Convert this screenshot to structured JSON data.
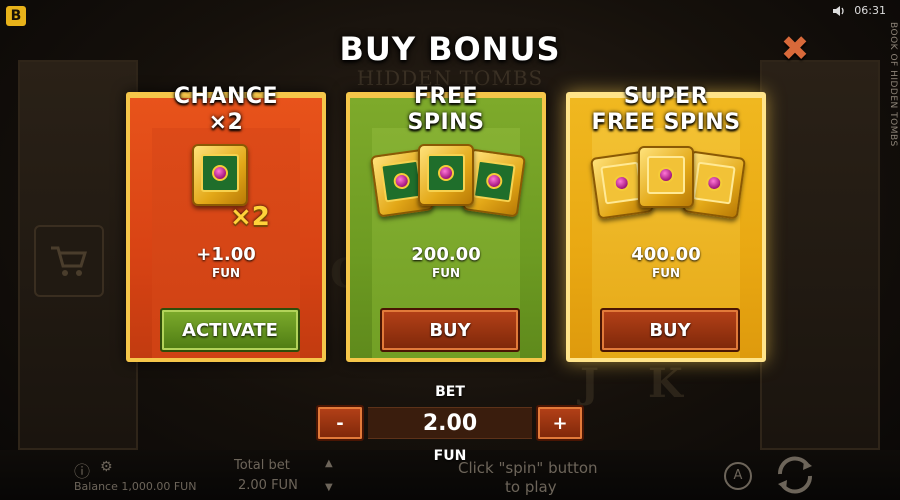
{
  "logo_letter": "B",
  "status": {
    "time": "06:31",
    "sound_icon": "speaker-icon"
  },
  "side_title": "BOOK OF HIDDEN TOMBS",
  "background": {
    "game_title": "HIDDEN TOMBS",
    "reel_letters": [
      "K",
      "J",
      "Q"
    ]
  },
  "modal": {
    "title": "BUY BONUS",
    "close_icon": "close-icon",
    "options": [
      {
        "title_line1": "CHANCE",
        "title_line2": "×2",
        "multiplier": "×2",
        "price": "+1.00",
        "currency": "FUN",
        "button": "ACTIVATE",
        "colors": {
          "card": "#e04c17",
          "button": "#5e8e1a"
        }
      },
      {
        "title_line1": "FREE",
        "title_line2": "SPINS",
        "price": "200.00",
        "currency": "FUN",
        "button": "BUY",
        "colors": {
          "card": "#74a124",
          "button": "#9c3511"
        }
      },
      {
        "title_line1": "SUPER",
        "title_line2": "FREE SPINS",
        "price": "400.00",
        "currency": "FUN",
        "button": "BUY",
        "colors": {
          "card": "#eab015",
          "button": "#9c3511"
        }
      }
    ],
    "bet": {
      "label": "BET",
      "value": "2.00",
      "currency": "FUN",
      "minus": "-",
      "plus": "+"
    }
  },
  "footer": {
    "balance": "Balance 1,000.00 FUN",
    "total_bet_label": "Total bet",
    "total_bet_value": "2.00 FUN",
    "hint_line1": "Click \"spin\" button",
    "hint_line2": "to play",
    "auto_label": "A"
  }
}
